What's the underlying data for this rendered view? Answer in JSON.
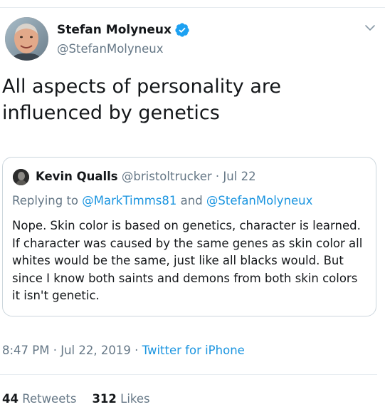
{
  "author": {
    "name": "Stefan Molyneux",
    "handle": "@StefanMolyneux",
    "verified": true
  },
  "tweet": {
    "text": "All aspects of personality are influenced by genetics"
  },
  "quote": {
    "name": "Kevin Qualls",
    "handle": "@bristoltrucker",
    "separator": "·",
    "date": "Jul 22",
    "reply_prefix": "Replying to",
    "reply_mention_1": "@MarkTimms81",
    "reply_and": "and",
    "reply_mention_2": "@StefanMolyneux",
    "body": "Nope. Skin color is based on genetics, character is learned. If character was caused by the same genes as skin color all whites would be the same, just like all blacks would. But since I know both saints and demons from both skin colors it isn't genetic."
  },
  "meta": {
    "time": "8:47 PM",
    "separator_1": "·",
    "date": "Jul 22, 2019",
    "separator_2": "·",
    "source": "Twitter for iPhone"
  },
  "stats": {
    "retweets_count": "44",
    "retweets_label": "Retweets",
    "likes_count": "312",
    "likes_label": "Likes"
  },
  "colors": {
    "accent": "#1b95e0",
    "verified": "#1da1f2",
    "muted": "#657786",
    "border": "#ccd6dd"
  },
  "icons": {
    "verified": "verified-badge-icon",
    "caret": "chevron-down-icon"
  }
}
